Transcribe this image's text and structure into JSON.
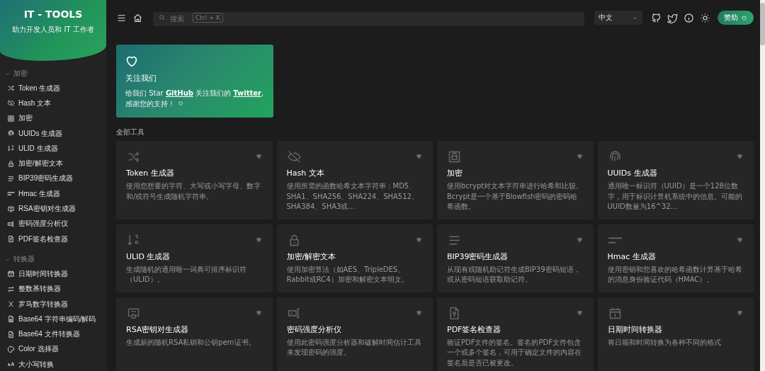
{
  "brand": {
    "title": "IT - TOOLS",
    "subtitle": "助力开发人员和 IT 工作者"
  },
  "sidebar": {
    "groups": [
      {
        "label": "加密",
        "expanded": true,
        "items": [
          {
            "label": "Token 生成器"
          },
          {
            "label": "Hash 文本"
          },
          {
            "label": "加密"
          },
          {
            "label": "UUIDs 生成器"
          },
          {
            "label": "ULID 生成器"
          },
          {
            "label": "加密/解密文本"
          },
          {
            "label": "BIP39密码生成器"
          },
          {
            "label": "Hmac 生成器"
          },
          {
            "label": "RSA密钥对生成器"
          },
          {
            "label": "密码强度分析仪"
          },
          {
            "label": "PDF签名检查器"
          }
        ]
      },
      {
        "label": "转换器",
        "expanded": true,
        "items": [
          {
            "label": "日期时间转换器"
          },
          {
            "label": "整数基转换器"
          },
          {
            "label": "罗马数字转换器"
          },
          {
            "label": "Base64 字符串编码/解码"
          },
          {
            "label": "Base64 文件转换器"
          },
          {
            "label": "Color 选择器"
          },
          {
            "label": "大小写转换"
          }
        ]
      }
    ]
  },
  "header": {
    "search": {
      "placeholder": "搜索",
      "shortcut": "Ctrl + K"
    },
    "language": "中文",
    "sponsor": "赞助"
  },
  "follow": {
    "title": "关注我们",
    "message": [
      {
        "kind": "text",
        "text": "给我们 Star "
      },
      {
        "kind": "link",
        "text": "GitHub"
      },
      {
        "kind": "text",
        "text": " 关注我们的 "
      },
      {
        "kind": "link",
        "text": "Twitter"
      },
      {
        "kind": "text",
        "text": ", 感谢您的支持！"
      }
    ]
  },
  "section_title": "全部工具",
  "tools": [
    {
      "title": "Token 生成器",
      "description": "使用您想要的字符、大写或小写字母、数字和/或符号生成随机字符串。"
    },
    {
      "title": "Hash 文本",
      "description": "使用所需的函数哈希文本字符串：MD5、SHA1、SHA256、SHA224、SHA512、SHA384、SHA3或..."
    },
    {
      "title": "加密",
      "description": "使用bcrypt对文本字符串进行哈希和比较。Bcrypt是一个基于Blowfish密码的密码哈希函数。"
    },
    {
      "title": "UUIDs 生成器",
      "description": "通用唯一标识符（UUID）是一个128位数字，用于标识计算机系统中的信息。可能的UUID数量为16^32..."
    },
    {
      "title": "ULID 生成器",
      "description": "生成随机的通用唯一词典可排序标识符（ULID）。"
    },
    {
      "title": "加密/解密文本",
      "description": "使用加密算法（如AES、TripleDES、Rabbit或RC4）加密和解密文本明文。"
    },
    {
      "title": "BIP39密码生成器",
      "description": "从现有或随机助记符生成BIP39密码短语，或从密码短语获取助记符。"
    },
    {
      "title": "Hmac 生成器",
      "description": "使用密钥和您喜欢的哈希函数计算基于哈希的消息身份验证代码（HMAC）。"
    },
    {
      "title": "RSA密钥对生成器",
      "description": "生成新的随机RSA私钥和公钥pem证书。"
    },
    {
      "title": "密码强度分析仪",
      "description": "使用此密码强度分析器和破解时间估计工具来发现密码的强度。"
    },
    {
      "title": "PDF签名检查器",
      "description": "验证PDF文件的签名。签名的PDF文件包含一个或多个签名，可用于确定文件的内容在签名后是否已被更改。"
    },
    {
      "title": "日期时间转换器",
      "description": "将日期和时间转换为各种不同的格式"
    }
  ]
}
